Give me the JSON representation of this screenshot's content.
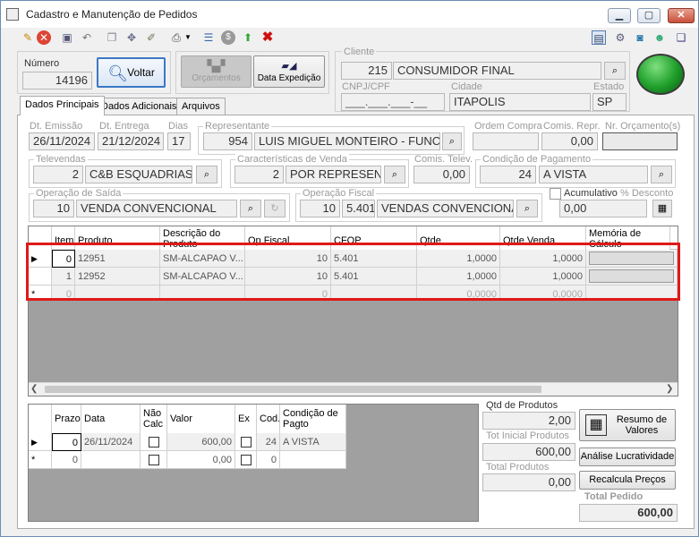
{
  "window": {
    "title": "Cadastro e Manutenção de Pedidos",
    "minimize": "▁",
    "restore": "▢",
    "close": "✕"
  },
  "toolbar": {
    "icons": [
      "edit-icon",
      "cancel-icon",
      "save-icon",
      "undo-icon",
      "copy-icon",
      "tools-icon",
      "broom-icon",
      "print-icon",
      "dropdown-icon",
      "list-icon",
      "dollar-icon",
      "export-icon",
      "delete-icon"
    ],
    "right_icons": [
      "layout-icon",
      "settings-icon",
      "refresh-icon",
      "user-icon",
      "help-icon"
    ]
  },
  "header": {
    "numero_label": "Número",
    "numero_value": "14196",
    "voltar_label": "Voltar",
    "orcamentos_label": "Orçamentos",
    "data_expedicao_label": "Data Expedição",
    "cliente_label": "Cliente",
    "cliente_code": "215",
    "cliente_name": "CONSUMIDOR FINAL",
    "cnpj_label": "CNPJ/CPF",
    "cnpj_value": "___.___.___-__",
    "cidade_label": "Cidade",
    "cidade_value": "ITAPOLIS",
    "estado_label": "Estado",
    "estado_value": "SP"
  },
  "tabs": [
    {
      "label": "Dados Principais"
    },
    {
      "label": "Dados Adicionais"
    },
    {
      "label": "Arquivos"
    }
  ],
  "fields": {
    "dt_emissao_label": "Dt. Emissão",
    "dt_emissao": "26/11/2024",
    "dt_entrega_label": "Dt. Entrega",
    "dt_entrega": "21/12/2024",
    "dias_label": "Dias",
    "dias": "17",
    "representante_label": "Representante",
    "representante_code": "954",
    "representante_name": "LUIS MIGUEL MONTEIRO - FUNCIC",
    "ordem_compra_label": "Ordem Compra",
    "ordem_compra": "",
    "comis_repr_label": "Comis. Repr.",
    "comis_repr": "0,00",
    "nr_orcamento_label": "Nr. Orçamento(s)",
    "nr_orcamento": "",
    "televendas_label": "Televendas",
    "televendas_code": "2",
    "televendas_name": "C&B ESQUADRIAS",
    "caracteristicas_label": "Características de Venda",
    "caracteristicas_code": "2",
    "caracteristicas_name": "POR REPRESENT",
    "comis_telev_label": "Comis. Telev.",
    "comis_telev": "0,00",
    "condicao_label": "Condição de Pagamento",
    "condicao_code": "24",
    "condicao_name": "A VISTA",
    "operacao_saida_label": "Operação de Saída",
    "operacao_saida_code": "10",
    "operacao_saida_name": "VENDA CONVENCIONAL",
    "operacao_fiscal_label": "Operação Fiscal",
    "operacao_fiscal_code": "10",
    "operacao_fiscal_cfop": "5.401",
    "operacao_fiscal_name": "VENDAS CONVENCIONA",
    "acumulativo_label": "Acumulativo",
    "desconto_label": "% Desconto",
    "desconto": "0,00"
  },
  "items_grid": {
    "headers": [
      "Item",
      "Produto",
      "Descrição do Produto",
      "Op.Fiscal",
      "CFOP",
      "Qtde",
      "Qtde.Venda",
      "Memória de Cálculo"
    ],
    "rows": [
      {
        "marker": "▶",
        "item": "0",
        "produto": "12951",
        "descricao": "SM-ALCAPAO V...",
        "opfiscal": "10",
        "cfop": "5.401",
        "qtde": "1,0000",
        "qtde_venda": "1,0000"
      },
      {
        "marker": "",
        "item": "1",
        "produto": "12952",
        "descricao": "SM-ALCAPAO V...",
        "opfiscal": "10",
        "cfop": "5.401",
        "qtde": "1,0000",
        "qtde_venda": "1,0000"
      },
      {
        "marker": "*",
        "item": "0",
        "produto": "",
        "descricao": "",
        "opfiscal": "0",
        "cfop": "",
        "qtde": "0,0000",
        "qtde_venda": "0,0000"
      }
    ]
  },
  "payments_grid": {
    "headers": [
      "Prazo",
      "Data",
      "Não Calc",
      "Valor",
      "Ex",
      "Cod.",
      "Condição de Pagto"
    ],
    "rows": [
      {
        "marker": "▶",
        "prazo": "0",
        "data": "26/11/2024",
        "valor": "600,00",
        "cod": "24",
        "condicao": "A VISTA"
      },
      {
        "marker": "*",
        "prazo": "0",
        "data": "",
        "valor": "0,00",
        "cod": "0",
        "condicao": ""
      }
    ]
  },
  "totals": {
    "qtd_produtos_label": "Qtd de Produtos",
    "qtd_produtos": "2,00",
    "tot_inicial_label": "Tot Inicial Produtos",
    "tot_inicial": "600,00",
    "total_produtos_label": "Total Produtos",
    "total_produtos": "0,00",
    "total_pedido_label": "Total Pedido",
    "total_pedido": "600,00",
    "resumo_label": "Resumo de Valores",
    "analise_label": "Análise Lucratividade",
    "recalcula_label": "Recalcula Preços"
  },
  "colors": {
    "highlight_box": "#e01818",
    "status_light": "#1e9e2a"
  }
}
